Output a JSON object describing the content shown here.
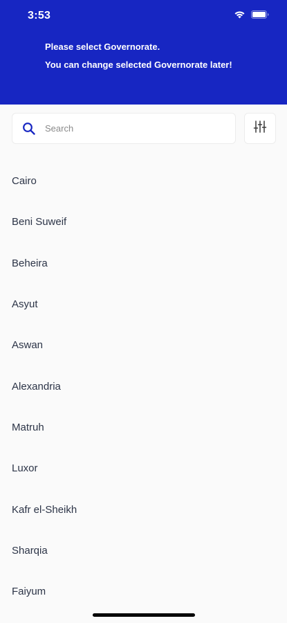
{
  "status_bar": {
    "time": "3:53"
  },
  "header": {
    "line1": "Please select Governorate.",
    "line2": "You can change selected Governorate later!",
    "background_color": "#1726c2"
  },
  "search": {
    "placeholder": "Search",
    "value": "",
    "icon": "search-icon",
    "icon_color": "#1726c2"
  },
  "filter": {
    "icon": "sliders-icon"
  },
  "governorates": [
    "Cairo",
    "Beni Suweif",
    "Beheira",
    "Asyut",
    "Aswan",
    "Alexandria",
    "Matruh",
    "Luxor",
    "Kafr el-Sheikh",
    "Sharqia",
    "Faiyum"
  ]
}
